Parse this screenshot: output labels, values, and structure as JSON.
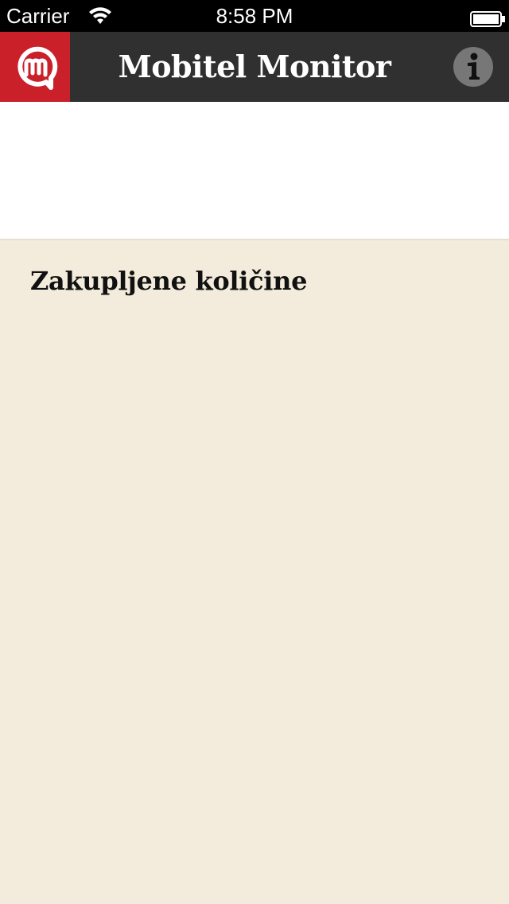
{
  "status_bar": {
    "carrier": "Carrier",
    "time": "8:58 PM",
    "wifi_icon": "wifi-icon",
    "battery_icon": "battery-icon"
  },
  "nav": {
    "title": "Mobitel Monitor",
    "logo_icon": "mobitel-logo-icon",
    "info_icon": "info-icon"
  },
  "main": {
    "section_title": "Zakupljene količine"
  },
  "colors": {
    "brand_red": "#c9202a",
    "nav_bg": "#303030",
    "content_bg": "#f3ecdc",
    "status_bg": "#000000",
    "info_circle": "#777777"
  }
}
